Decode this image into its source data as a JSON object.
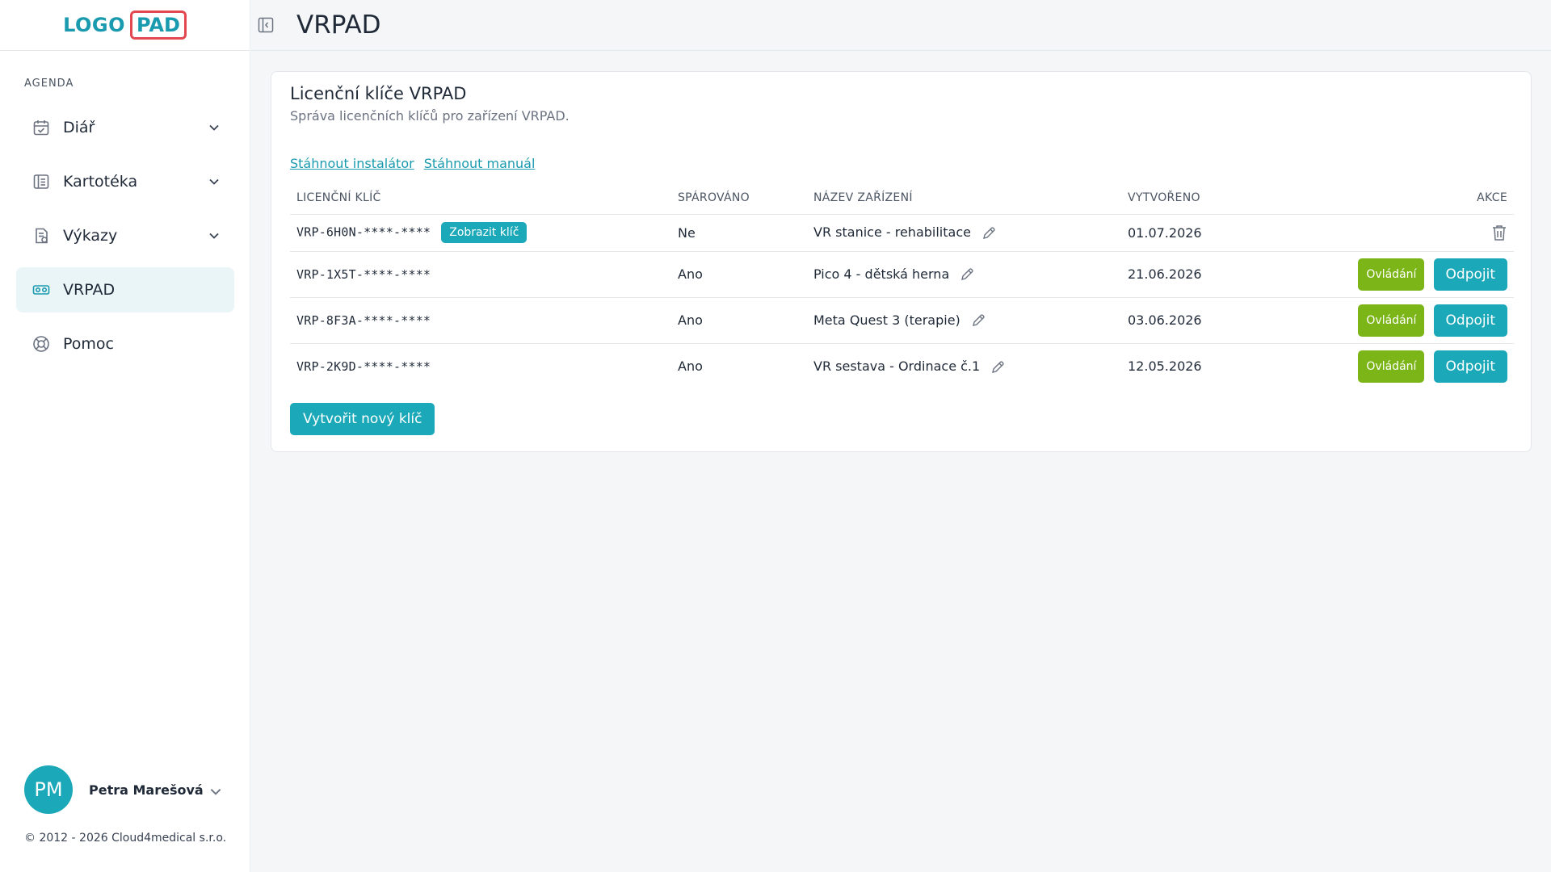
{
  "logo": {
    "left": "LOGO",
    "right": "PAD"
  },
  "sidebar": {
    "section_label": "AGENDA",
    "items": [
      {
        "label": "Diář",
        "icon": "calendar-icon",
        "has_chevron": true,
        "active": false
      },
      {
        "label": "Kartotéka",
        "icon": "card-file-icon",
        "has_chevron": true,
        "active": false
      },
      {
        "label": "Výkazy",
        "icon": "report-icon",
        "has_chevron": true,
        "active": false
      },
      {
        "label": "VRPAD",
        "icon": "vr-headset-icon",
        "has_chevron": false,
        "active": true
      },
      {
        "label": "Pomoc",
        "icon": "lifebuoy-icon",
        "has_chevron": false,
        "active": false
      }
    ],
    "user": {
      "initials": "PM",
      "name": "Petra Marešová"
    },
    "copyright": "© 2012 - 2026 Cloud4medical s.r.o."
  },
  "header": {
    "title": "VRPAD"
  },
  "card": {
    "title": "Licenční klíče VRPAD",
    "subtitle": "Správa licenčních klíčů pro zařízení VRPAD.",
    "links": {
      "installer": "Stáhnout instalátor",
      "manual": "Stáhnout manuál"
    },
    "columns": {
      "key": "LICENČNÍ KLÍČ",
      "paired": "SPÁROVÁNO",
      "device": "NÁZEV ZAŘÍZENÍ",
      "created": "VYTVOŘENO",
      "actions": "AKCE"
    },
    "rows": [
      {
        "key": "VRP-6H0N-****-****",
        "paired": "Ne",
        "device": "VR stanice - rehabilitace",
        "created": "01.07.2026"
      },
      {
        "key": "VRP-1X5T-****-****",
        "paired": "Ano",
        "device": "Pico 4 - dětská herna",
        "created": "21.06.2026"
      },
      {
        "key": "VRP-8F3A-****-****",
        "paired": "Ano",
        "device": "Meta Quest 3 (terapie)",
        "created": "03.06.2026"
      },
      {
        "key": "VRP-2K9D-****-****",
        "paired": "Ano",
        "device": "VR sestava - Ordinace č.1",
        "created": "12.05.2026"
      }
    ],
    "show_key_label": "Zobrazit klíč",
    "control_label": "Ovládání",
    "disconnect_label": "Odpojit",
    "new_key_label": "Vytvořit nový klíč"
  },
  "colors": {
    "accent": "#1ba8b8",
    "green": "#7cb518",
    "logo_border": "#e3474f"
  }
}
